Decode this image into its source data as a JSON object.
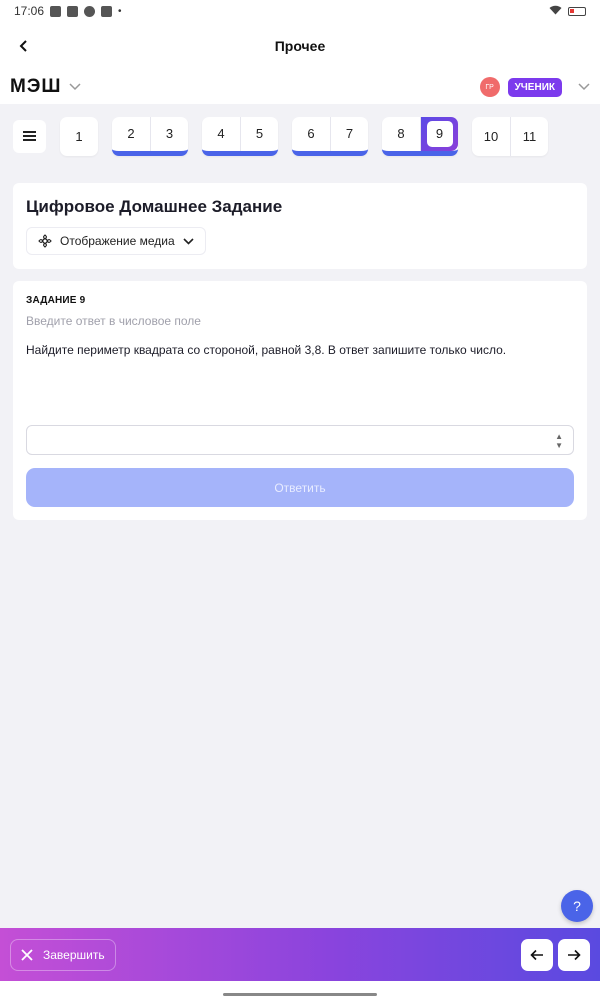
{
  "status_bar": {
    "time": "17:06",
    "icons": [
      "youtube-icon",
      "vk-icon",
      "chat-icon",
      "image-icon"
    ],
    "dot": "•",
    "right_icons": [
      "wifi-icon",
      "battery-icon"
    ]
  },
  "app_bar": {
    "title": "Прочее"
  },
  "mesh": {
    "logo": "МЭШ",
    "avatar_initials": "ГР",
    "role": "УЧЕНИК"
  },
  "lessons": {
    "groups": [
      {
        "items": [
          "1"
        ],
        "underlined": false
      },
      {
        "items": [
          "2",
          "3"
        ],
        "underlined": true
      },
      {
        "items": [
          "4",
          "5"
        ],
        "underlined": true
      },
      {
        "items": [
          "6",
          "7"
        ],
        "underlined": true
      },
      {
        "items": [
          "8",
          "9"
        ],
        "underlined": true,
        "current": "9"
      },
      {
        "items": [
          "10",
          "11"
        ],
        "underlined": false
      }
    ]
  },
  "homework": {
    "title": "Цифровое Домашнее Задание",
    "media_button": "Отображение медиа"
  },
  "task": {
    "label": "ЗАДАНИЕ 9",
    "hint": "Введите ответ в числовое поле",
    "text": "Найдите периметр квадрата со стороной, равной 3,8. В ответ запишите только число.",
    "input_value": "",
    "spin_up": "▲",
    "spin_down": "▼",
    "submit_label": "Ответить"
  },
  "help": {
    "label": "?"
  },
  "bottom_bar": {
    "finish_label": "Завершить"
  },
  "colors": {
    "accent": "#4a64e8",
    "role_badge": "#7c3aed",
    "gradient_start": "#c44fd6",
    "gradient_end": "#5a4ae0"
  }
}
